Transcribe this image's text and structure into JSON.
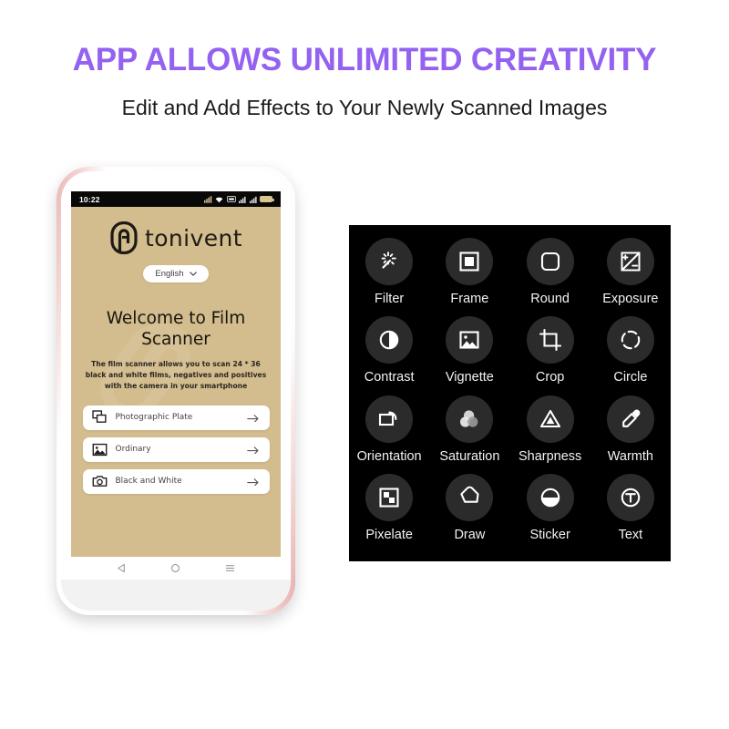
{
  "header": {
    "headline": "APP ALLOWS UNLIMITED CREATIVITY",
    "subheadline": "Edit and Add Effects to Your Newly Scanned Images",
    "headline_color": "#9461f0",
    "subheadline_color": "#1b1b1b"
  },
  "phone": {
    "frame_color": "#e8b4b8",
    "screen_bg": "#d3bc8d",
    "statusbar": {
      "time": "10:22",
      "icons": [
        "signal-data-icon",
        "wifi-icon",
        "sim-card-icon",
        "cellular-1-icon",
        "cellular-2-icon",
        "battery-icon"
      ]
    },
    "brand": {
      "logo_icon": "tonivent-logo-icon",
      "name": "tonivent"
    },
    "language": {
      "value": "English",
      "chevron_icon": "chevron-down-icon"
    },
    "welcome": {
      "title": "Welcome to Film Scanner",
      "description": "The film scanner allows you to scan 24 * 36 black and white films, negatives and positives with the camera in your smartphone"
    },
    "options": [
      {
        "label": "Photographic Plate",
        "icon": "plates-stack-icon",
        "arrow_icon": "arrow-right-icon"
      },
      {
        "label": "Ordinary",
        "icon": "image-icon",
        "arrow_icon": "arrow-right-icon"
      },
      {
        "label": "Black and White",
        "icon": "camera-icon",
        "arrow_icon": "arrow-right-icon"
      }
    ],
    "navbar": [
      {
        "name": "back-button",
        "icon": "triangle-back-icon"
      },
      {
        "name": "home-button",
        "icon": "circle-home-icon"
      },
      {
        "name": "recents-button",
        "icon": "menu-recents-icon"
      }
    ]
  },
  "editor": {
    "background": "#000000",
    "circle_color": "#2b2b2b",
    "tools": [
      {
        "label": "Filter",
        "icon": "magic-wand-icon"
      },
      {
        "label": "Frame",
        "icon": "frame-square-icon"
      },
      {
        "label": "Round",
        "icon": "rounded-square-icon"
      },
      {
        "label": "Exposure",
        "icon": "exposure-icon"
      },
      {
        "label": "Contrast",
        "icon": "contrast-half-circle-icon"
      },
      {
        "label": "Vignette",
        "icon": "image-vignette-icon"
      },
      {
        "label": "Crop",
        "icon": "crop-icon"
      },
      {
        "label": "Circle",
        "icon": "dashed-circle-icon"
      },
      {
        "label": "Orientation",
        "icon": "rotate-rectangle-icon"
      },
      {
        "label": "Saturation",
        "icon": "three-circles-icon"
      },
      {
        "label": "Sharpness",
        "icon": "triangle-sharpness-icon"
      },
      {
        "label": "Warmth",
        "icon": "eyedropper-icon"
      },
      {
        "label": "Pixelate",
        "icon": "pixelate-squares-icon"
      },
      {
        "label": "Draw",
        "icon": "pencil-draw-icon"
      },
      {
        "label": "Sticker",
        "icon": "sticker-half-fill-icon"
      },
      {
        "label": "Text",
        "icon": "text-t-circle-icon"
      }
    ]
  }
}
